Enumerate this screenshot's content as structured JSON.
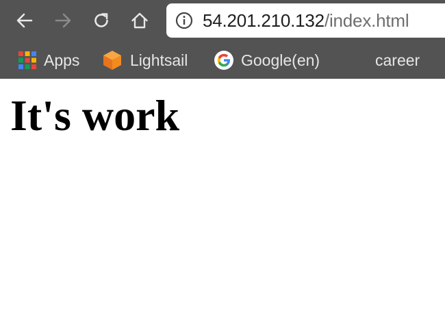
{
  "browser": {
    "nav": {
      "back_icon": "arrow-left-icon",
      "forward_icon": "arrow-right-icon",
      "reload_icon": "reload-icon",
      "home_icon": "home-icon"
    },
    "address": {
      "host": "54.201.210.132",
      "path": "/index.html",
      "info_icon": "info-icon"
    },
    "bookmarks": [
      {
        "label": "Apps",
        "icon": "apps-grid-icon"
      },
      {
        "label": "Lightsail",
        "icon": "lightsail-cube-icon"
      },
      {
        "label": "Google(en)",
        "icon": "google-g-icon"
      },
      {
        "label": "career",
        "icon": ""
      }
    ],
    "colors": {
      "toolbar_bg": "#535353",
      "omnibox_bg": "#ffffff",
      "page_bg": "#ffffff"
    }
  },
  "page": {
    "heading": "It's work"
  }
}
